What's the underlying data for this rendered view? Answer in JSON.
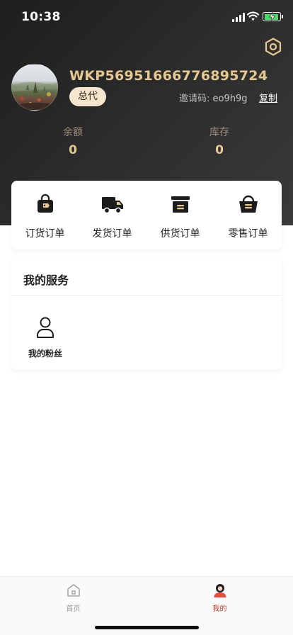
{
  "status_bar": {
    "time": "10:38"
  },
  "profile": {
    "username": "WKP56951666776895724",
    "role": "总代",
    "invite_label": "邀请码:",
    "invite_code": "eo9h9g",
    "copy_label": "复制"
  },
  "stats": [
    {
      "label": "余额",
      "value": "0"
    },
    {
      "label": "库存",
      "value": "0"
    }
  ],
  "orders": [
    {
      "label": "订货订单",
      "icon": "shopping-bag-tag-icon"
    },
    {
      "label": "发货订单",
      "icon": "delivery-truck-icon"
    },
    {
      "label": "供货订单",
      "icon": "archive-box-icon"
    },
    {
      "label": "零售订单",
      "icon": "basket-icon"
    }
  ],
  "services": {
    "title": "我的服务",
    "items": [
      {
        "label": "我的粉丝",
        "icon": "person-outline-icon"
      }
    ]
  },
  "tab_bar": {
    "items": [
      {
        "label": "首页",
        "icon": "home-icon",
        "active": false
      },
      {
        "label": "我的",
        "icon": "profile-avatar-icon",
        "active": true
      }
    ],
    "active_color": "#c0392b",
    "inactive_color": "#9a9a9a"
  },
  "colors": {
    "accent_gold": "#e6c892",
    "header_dark": "#2b2b2b",
    "badge_bg": "#f7e6cf"
  }
}
